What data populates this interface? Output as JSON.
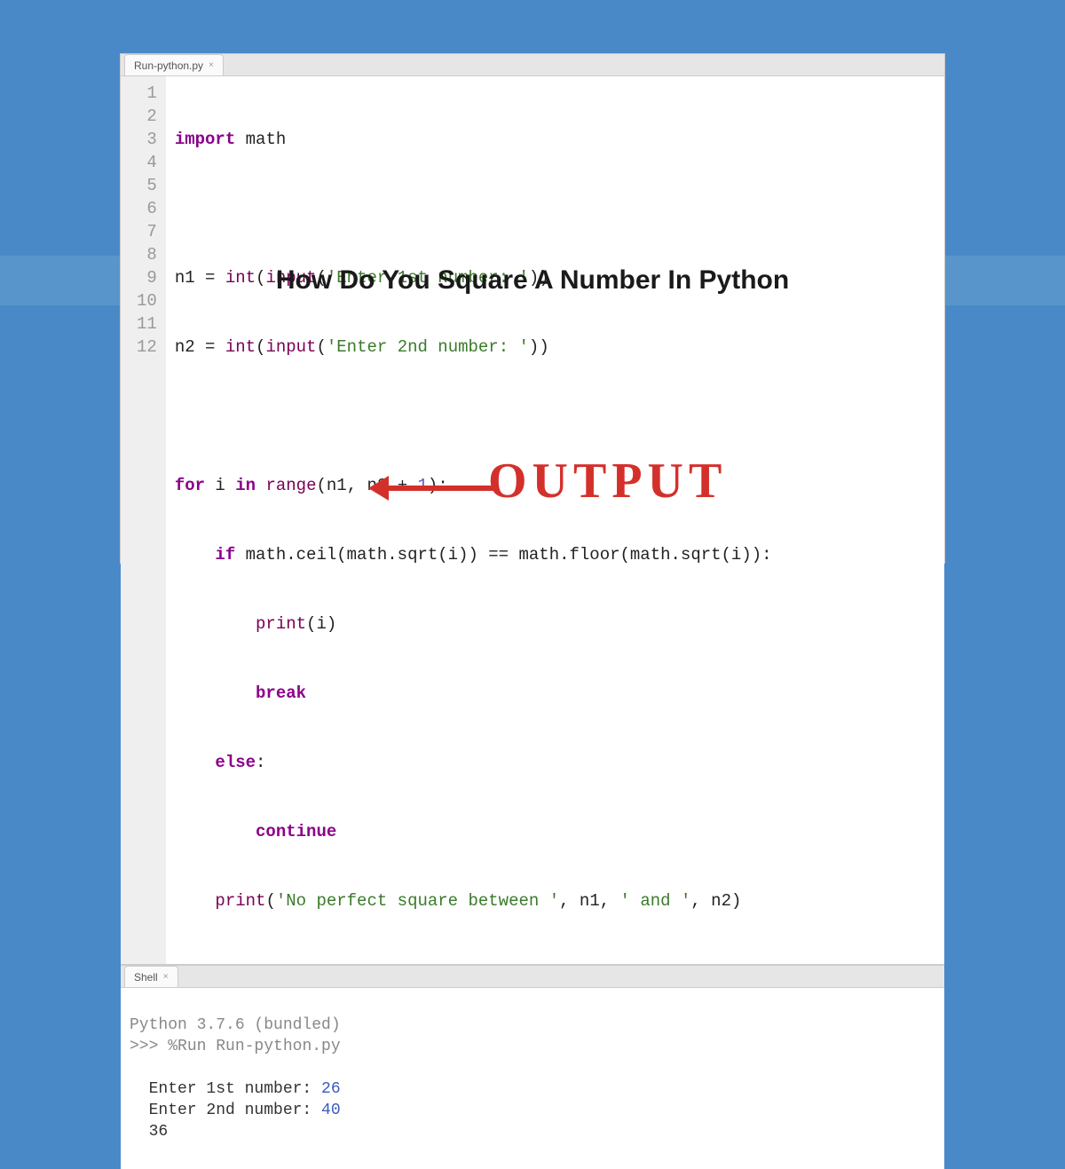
{
  "banner": {
    "title": "How Do You Square A Number In Python"
  },
  "editor": {
    "tab_label": "Run-python.py",
    "gutter": [
      "1",
      "2",
      "3",
      "4",
      "5",
      "6",
      "7",
      "8",
      "9",
      "10",
      "11",
      "12"
    ],
    "code": {
      "l1_kw": "import",
      "l1_rest": " math",
      "l3_a": "n1 = ",
      "l3_fn": "int",
      "l3_b": "(",
      "l3_fn2": "input",
      "l3_c": "(",
      "l3_str": "'Enter 1st number: '",
      "l3_d": "))",
      "l4_a": "n2 = ",
      "l4_fn": "int",
      "l4_b": "(",
      "l4_fn2": "input",
      "l4_c": "(",
      "l4_str": "'Enter 2nd number: '",
      "l4_d": "))",
      "l6_for": "for",
      "l6_a": " i ",
      "l6_in": "in",
      "l6_b": " ",
      "l6_range": "range",
      "l6_c": "(n1, n2 + ",
      "l6_num": "1",
      "l6_d": "):",
      "l7_pad": "    ",
      "l7_if": "if",
      "l7_a": " math.ceil(math.sqrt(i)) == math.floor(math.sqrt(i)):",
      "l8_pad": "        ",
      "l8_print": "print",
      "l8_a": "(i)",
      "l9_pad": "        ",
      "l9_break": "break",
      "l10_pad": "    ",
      "l10_else": "else",
      "l10_a": ":",
      "l11_pad": "        ",
      "l11_cont": "continue",
      "l12_pad": "    ",
      "l12_print": "print",
      "l12_a": "(",
      "l12_str1": "'No perfect square between '",
      "l12_b": ", n1, ",
      "l12_str2": "' and '",
      "l12_c": ", n2)"
    }
  },
  "shell": {
    "tab_label": "Shell",
    "line1": "Python 3.7.6 (bundled)",
    "prompt": ">>> ",
    "cmd": "%Run Run-python.py",
    "in1_label": "  Enter 1st number: ",
    "in1_val": "26",
    "in2_label": "  Enter 2nd number: ",
    "in2_val": "40",
    "out": "  36"
  },
  "annotation": {
    "text": "OUTPUT"
  }
}
